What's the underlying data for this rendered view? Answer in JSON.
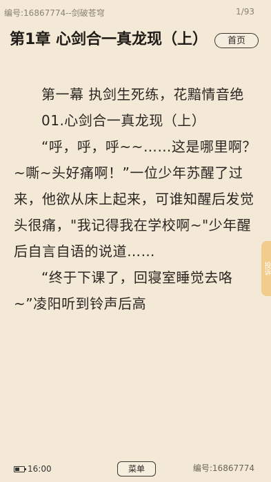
{
  "topbar": {
    "book_id": "编号:16867774--剑破苍穹",
    "page": "1/93"
  },
  "chapter": {
    "title": "第1章 心剑合一真龙现（上）"
  },
  "home_button": "首页",
  "content": {
    "paragraphs": [
      "第一幕 执剑生死练，花黯情音绝",
      "01.心剑合一真龙现（上）",
      "“呼，呼，呼~~……这是哪里啊？~嘶~头好痛啊！”一位少年苏醒了过来，他欲从床上起来，可谁知醒后发觉头很痛，\"我记得我在学校啊~\"少年醒后自言自语的说道……",
      "“终于下课了，回寝室睡觉去咯~”凌阳听到铃声后高"
    ]
  },
  "side_tab": "投诉",
  "bottombar": {
    "time": "16:00",
    "menu": "菜单",
    "book_id": "编号:16867774"
  }
}
